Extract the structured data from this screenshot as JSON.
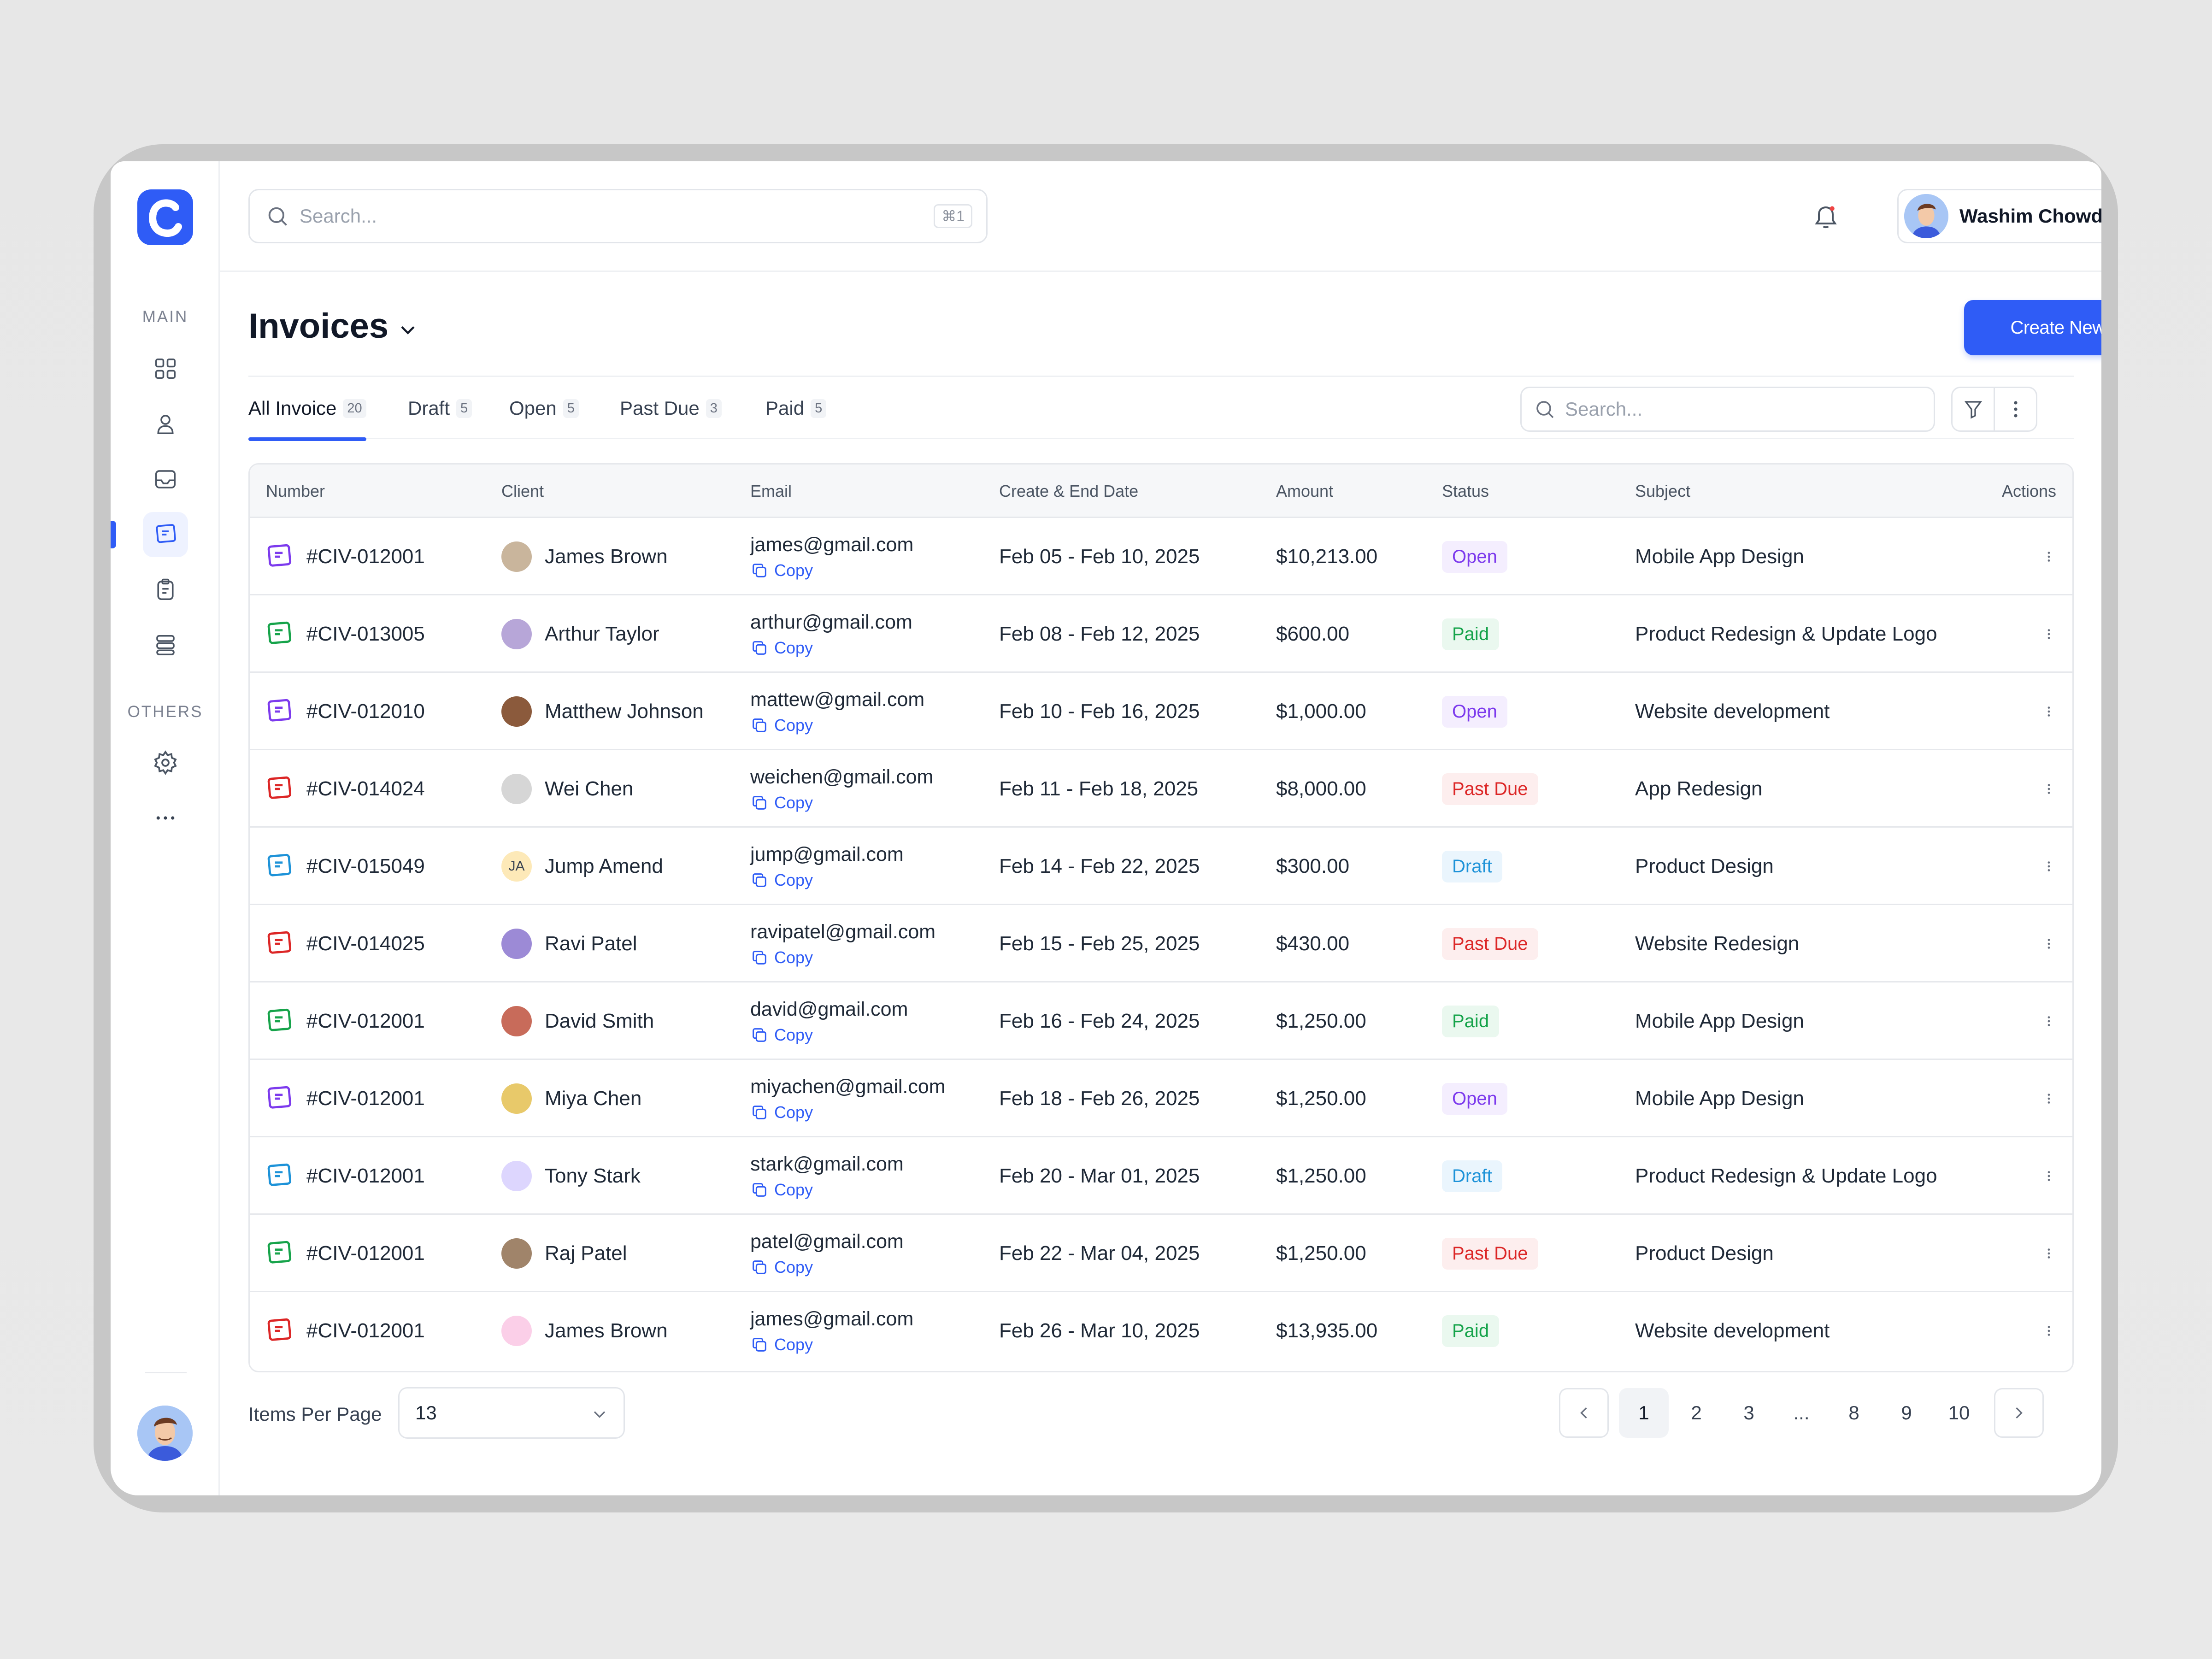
{
  "sidebar": {
    "main_label": "MAIN",
    "others_label": "OTHERS",
    "items": [
      {
        "icon": "grid-icon"
      },
      {
        "icon": "user-icon"
      },
      {
        "icon": "mail-icon"
      },
      {
        "icon": "invoice-icon",
        "active": true
      },
      {
        "icon": "clipboard-icon"
      },
      {
        "icon": "database-icon"
      },
      {
        "icon": "gear-icon"
      },
      {
        "icon": "more-horizontal-icon"
      }
    ]
  },
  "header": {
    "search_placeholder": "Search...",
    "search_shortcut": "⌘1",
    "user_name": "Washim Chowdhury"
  },
  "page": {
    "title": "Invoices",
    "create_button": "Create New Invoice",
    "search_placeholder": "Search..."
  },
  "tabs": [
    {
      "label": "All Invoice",
      "count": "20",
      "active": true
    },
    {
      "label": "Draft",
      "count": "5"
    },
    {
      "label": "Open",
      "count": "5"
    },
    {
      "label": "Past Due",
      "count": "3"
    },
    {
      "label": "Paid",
      "count": "5"
    }
  ],
  "table": {
    "columns": [
      "Number",
      "Client",
      "Email",
      "Create & End Date",
      "Amount",
      "Status",
      "Subject",
      "Actions"
    ],
    "copy_label": "Copy",
    "rows": [
      {
        "number": "#CIV-012001",
        "icon_color": "#7c3aed",
        "client": "James Brown",
        "avatar_color": "#c9b59c",
        "email": "james@gmail.com",
        "dates": "Feb 05 - Feb 10, 2025",
        "amount": "$10,213.00",
        "status": "Open",
        "status_class": "open",
        "subject": "Mobile App Design"
      },
      {
        "number": "#CIV-013005",
        "icon_color": "#16a34a",
        "client": "Arthur Taylor",
        "avatar_color": "#b7a6d8",
        "email": "arthur@gmail.com",
        "dates": "Feb 08 - Feb 12, 2025",
        "amount": "$600.00",
        "status": "Paid",
        "status_class": "paid",
        "subject": "Product Redesign & Update Logo"
      },
      {
        "number": "#CIV-012010",
        "icon_color": "#7c3aed",
        "client": "Matthew Johnson",
        "avatar_color": "#8b5a3c",
        "email": "mattew@gmail.com",
        "dates": "Feb 10 - Feb 16, 2025",
        "amount": "$1,000.00",
        "status": "Open",
        "status_class": "open",
        "subject": "Website development"
      },
      {
        "number": "#CIV-014024",
        "icon_color": "#dc2626",
        "client": "Wei Chen",
        "avatar_color": "#d6d6d6",
        "email": "weichen@gmail.com",
        "dates": "Feb 11 - Feb 18, 2025",
        "amount": "$8,000.00",
        "status": "Past Due",
        "status_class": "pastdue",
        "subject": "App Redesign"
      },
      {
        "number": "#CIV-015049",
        "icon_color": "#1d92d8",
        "client": "Jump Amend",
        "avatar_initials": "JA",
        "avatar_color": "#fde9b8",
        "email": "jump@gmail.com",
        "dates": "Feb 14 - Feb 22, 2025",
        "amount": "$300.00",
        "status": "Draft",
        "status_class": "draft",
        "subject": "Product Design"
      },
      {
        "number": "#CIV-014025",
        "icon_color": "#dc2626",
        "client": "Ravi Patel",
        "avatar_color": "#9c8ad6",
        "email": "ravipatel@gmail.com",
        "dates": "Feb 15 - Feb 25, 2025",
        "amount": "$430.00",
        "status": "Past Due",
        "status_class": "pastdue",
        "subject": "Website Redesign"
      },
      {
        "number": "#CIV-012001",
        "icon_color": "#16a34a",
        "client": "David Smith",
        "avatar_color": "#c86b5a",
        "email": "david@gmail.com",
        "dates": "Feb 16 - Feb 24, 2025",
        "amount": "$1,250.00",
        "status": "Paid",
        "status_class": "paid",
        "subject": "Mobile App Design"
      },
      {
        "number": "#CIV-012001",
        "icon_color": "#7c3aed",
        "client": "Miya Chen",
        "avatar_color": "#e8c96a",
        "email": "miyachen@gmail.com",
        "dates": "Feb 18 - Feb 26, 2025",
        "amount": "$1,250.00",
        "status": "Open",
        "status_class": "open",
        "subject": "Mobile App Design"
      },
      {
        "number": "#CIV-012001",
        "icon_color": "#1d92d8",
        "client": "Tony Stark",
        "avatar_color": "#ddd6fe",
        "email": "stark@gmail.com",
        "dates": "Feb 20 - Mar 01, 2025",
        "amount": "$1,250.00",
        "status": "Draft",
        "status_class": "draft",
        "subject": "Product Redesign & Update Logo"
      },
      {
        "number": "#CIV-012001",
        "icon_color": "#16a34a",
        "client": "Raj Patel",
        "avatar_color": "#a0846a",
        "email": "patel@gmail.com",
        "dates": "Feb 22 - Mar 04, 2025",
        "amount": "$1,250.00",
        "status": "Past Due",
        "status_class": "pastdue",
        "subject": "Product Design"
      },
      {
        "number": "#CIV-012001",
        "icon_color": "#dc2626",
        "client": "James Brown",
        "avatar_color": "#fbcfe8",
        "email": "james@gmail.com",
        "dates": "Feb 26 - Mar 10, 2025",
        "amount": "$13,935.00",
        "status": "Paid",
        "status_class": "paid",
        "subject": "Website development"
      }
    ]
  },
  "footer": {
    "items_per_page_label": "Items Per Page",
    "items_per_page_value": "13",
    "pages": [
      "1",
      "2",
      "3",
      "...",
      "8",
      "9",
      "10"
    ],
    "active_page": "1"
  },
  "colors": {
    "accent": "#2f5cf6",
    "open": "#7c3aed",
    "paid": "#16a34a",
    "past_due": "#dc2626",
    "draft": "#1d92d8"
  }
}
